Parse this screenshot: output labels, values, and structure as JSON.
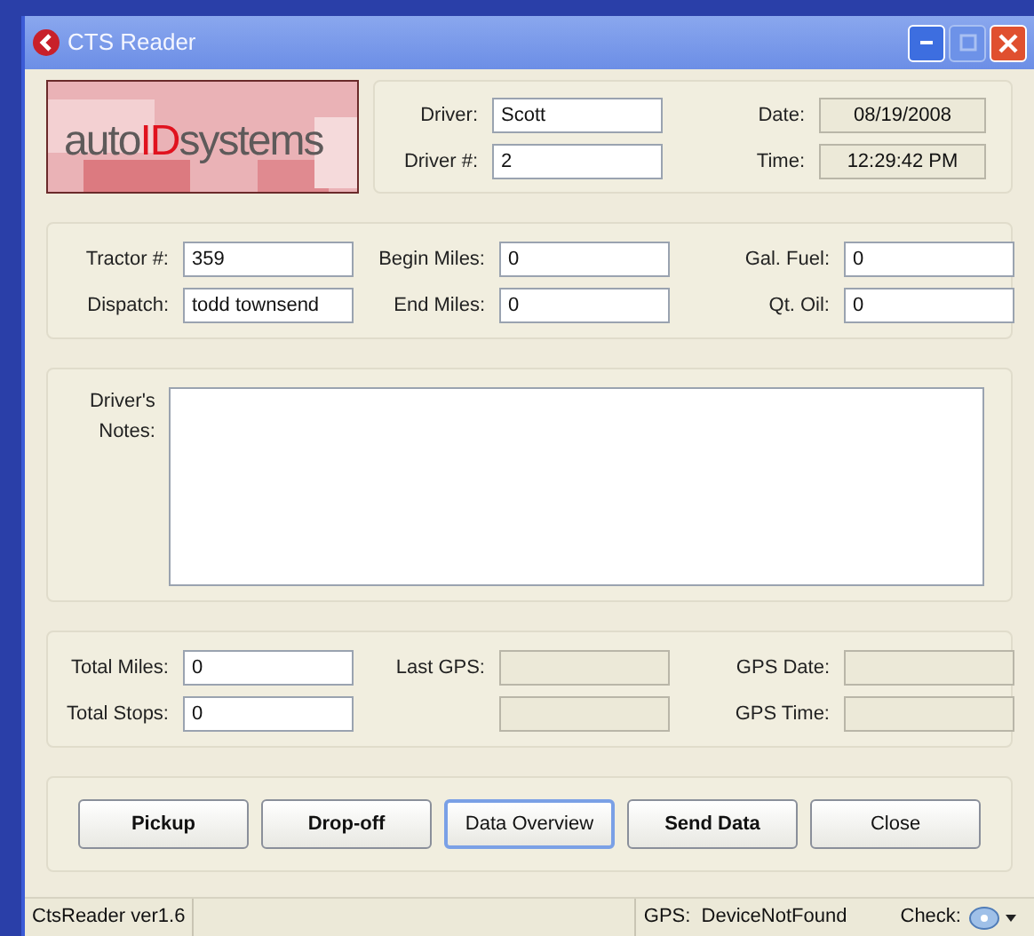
{
  "window": {
    "title": "CTS Reader"
  },
  "logo": {
    "parts": [
      {
        "text": "auto",
        "kind": "plain"
      },
      {
        "text": "ID",
        "kind": "accent"
      },
      {
        "text": "systems",
        "kind": "plain"
      }
    ]
  },
  "driver_fields": [
    {
      "label": "Driver:",
      "value": "Scott",
      "readonly": false
    },
    {
      "label": "Driver #:",
      "value": "2",
      "readonly": false
    }
  ],
  "clock_fields": [
    {
      "label": "Date:",
      "value": "08/19/2008",
      "readonly": true
    },
    {
      "label": "Time:",
      "value": "12:29:42 PM",
      "readonly": true
    }
  ],
  "trip_fields": [
    {
      "label": "Tractor #:",
      "value": "359",
      "readonly": false
    },
    {
      "label": "Begin Miles:",
      "value": "0",
      "readonly": false
    },
    {
      "label": "Gal. Fuel:",
      "value": "0",
      "readonly": false
    },
    {
      "label": "Dispatch:",
      "value": "todd townsend",
      "readonly": false
    },
    {
      "label": "End Miles:",
      "value": "0",
      "readonly": false
    },
    {
      "label": "Qt. Oil:",
      "value": "0",
      "readonly": false
    }
  ],
  "notes": {
    "label": "Driver's Notes:"
  },
  "gps_fields": [
    {
      "label": "Total Miles:",
      "value": "0",
      "readonly": false
    },
    {
      "label": "Last GPS:",
      "readonly": true
    },
    {
      "label": "GPS Date:",
      "readonly": true
    },
    {
      "label": "Total Stops:",
      "value": "0",
      "readonly": false
    },
    {
      "readonly": true
    },
    {
      "label": "GPS Time:",
      "readonly": true
    }
  ],
  "buttons": [
    {
      "label": "Pickup",
      "bold": true,
      "selected": false
    },
    {
      "label": "Drop-off",
      "bold": true,
      "selected": false
    },
    {
      "label": "Data Overview",
      "bold": false,
      "selected": true
    },
    {
      "label": "Send Data",
      "bold": true,
      "selected": false
    },
    {
      "label": "Close",
      "bold": false,
      "selected": false
    }
  ],
  "status_bar": {
    "version": "CtsReader ver1.6",
    "gps": "GPS:  DeviceNotFound",
    "check": "Check:"
  }
}
